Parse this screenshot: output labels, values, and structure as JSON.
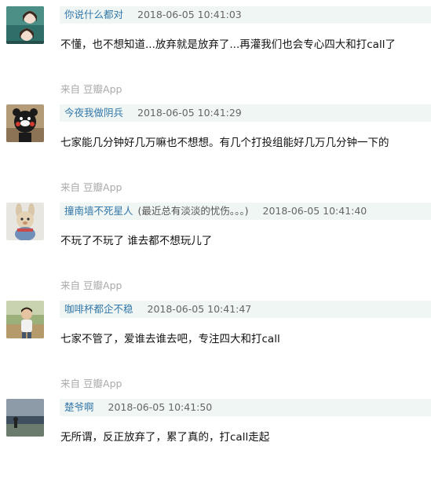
{
  "comments": [
    {
      "author": "你说什么都对",
      "signature": "",
      "time": "2018-06-05 10:41:03",
      "text": "不懂，也不想知道...放弃就是放弃了...再灌我们也会专心四大和打call了",
      "source_prefix": "来自",
      "source_app": "豆瓣App",
      "avatar": "avatar-two-girls"
    },
    {
      "author": "今夜我做阴兵",
      "signature": "",
      "time": "2018-06-05 10:41:29",
      "text": "七家能几分钟好几万嘛也不想想。有几个打投组能好几万几分钟一下的",
      "source_prefix": "来自",
      "source_app": "豆瓣App",
      "avatar": "avatar-kumamon"
    },
    {
      "author": "撞南墙不死星人",
      "signature": "(最近总有淡淡的忧伤。。。)",
      "time": "2018-06-05 10:41:40",
      "text": "不玩了不玩了 谁去都不想玩儿了",
      "source_prefix": "来自",
      "source_app": "豆瓣App",
      "avatar": "avatar-plush-bunny"
    },
    {
      "author": "咖啡杯都企不稳",
      "signature": "",
      "time": "2018-06-05 10:41:47",
      "text": "七家不管了，爱谁去谁去吧，专注四大和打call",
      "source_prefix": "来自",
      "source_app": "豆瓣App",
      "avatar": "avatar-boy-outdoor"
    },
    {
      "author": "楚爷啊",
      "signature": "",
      "time": "2018-06-05 10:41:50",
      "text": "无所谓，反正放弃了，累了真的，打call走起",
      "source_prefix": "",
      "source_app": "",
      "avatar": "avatar-seaside-person"
    }
  ],
  "colors": {
    "header_bg": "#f0f6f3",
    "author_link": "#3377aa",
    "source_text": "#aaaaaa"
  }
}
